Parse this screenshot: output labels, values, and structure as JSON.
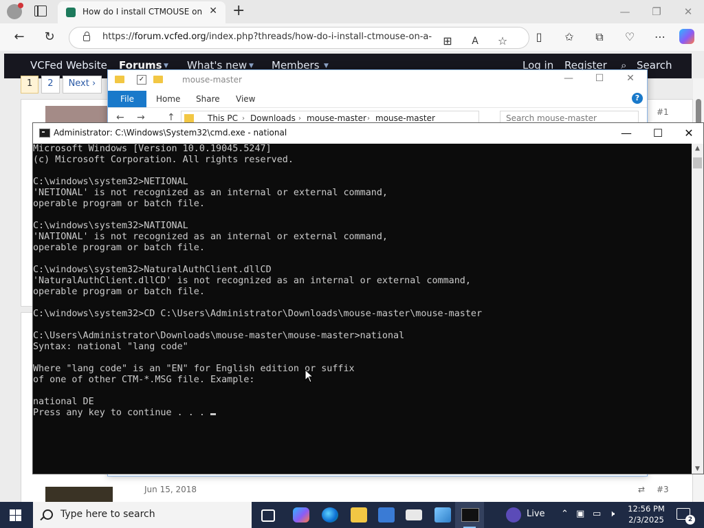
{
  "browser": {
    "tab_title": "How do I install CTMOUSE on a d",
    "new_tab_glyph": "+",
    "url_prefix": "https://",
    "url_host": "forum.vcfed.org",
    "url_path": "/index.php?threads/how-do-i-install-ctmouse-on-a-..."
  },
  "site": {
    "nav": {
      "website": "VCFed Website",
      "forums": "Forums",
      "whats_new": "What's new",
      "members": "Members",
      "login": "Log in",
      "register": "Register",
      "search": "Search"
    },
    "pager": {
      "page1": "1",
      "page2": "2",
      "next": "Next ›"
    },
    "post_top_number": "#1",
    "post_bottom_date": "Jun 15, 2018",
    "post_bottom_number": "#3"
  },
  "explorer": {
    "title": "mouse-master",
    "ribbon": {
      "file": "File",
      "home": "Home",
      "share": "Share",
      "view": "View"
    },
    "path": [
      "This PC",
      "Downloads",
      "mouse-master",
      "mouse-master"
    ],
    "search_placeholder": "Search mouse-master"
  },
  "cmd": {
    "title": "Administrator: C:\\Windows\\System32\\cmd.exe - national",
    "lines": [
      "Microsoft Windows [Version 10.0.19045.5247]",
      "(c) Microsoft Corporation. All rights reserved.",
      "",
      "C:\\windows\\system32>NETIONAL",
      "'NETIONAL' is not recognized as an internal or external command,",
      "operable program or batch file.",
      "",
      "C:\\windows\\system32>NATIONAL",
      "'NATIONAL' is not recognized as an internal or external command,",
      "operable program or batch file.",
      "",
      "C:\\windows\\system32>NaturalAuthClient.dllCD",
      "'NaturalAuthClient.dllCD' is not recognized as an internal or external command,",
      "operable program or batch file.",
      "",
      "C:\\windows\\system32>CD C:\\Users\\Administrator\\Downloads\\mouse-master\\mouse-master",
      "",
      "C:\\Users\\Administrator\\Downloads\\mouse-master\\mouse-master>national",
      "Syntax: national \"lang code\"",
      "",
      "Where \"lang code\" is an \"EN\" for English edition or suffix",
      "of one of other CTM-*.MSG file. Example:",
      "",
      "national DE",
      "Press any key to continue . . . "
    ]
  },
  "taskbar": {
    "search_placeholder": "Type here to search",
    "live_label": "Live",
    "time": "12:56 PM",
    "date": "2/3/2025",
    "notification_count": "2"
  }
}
